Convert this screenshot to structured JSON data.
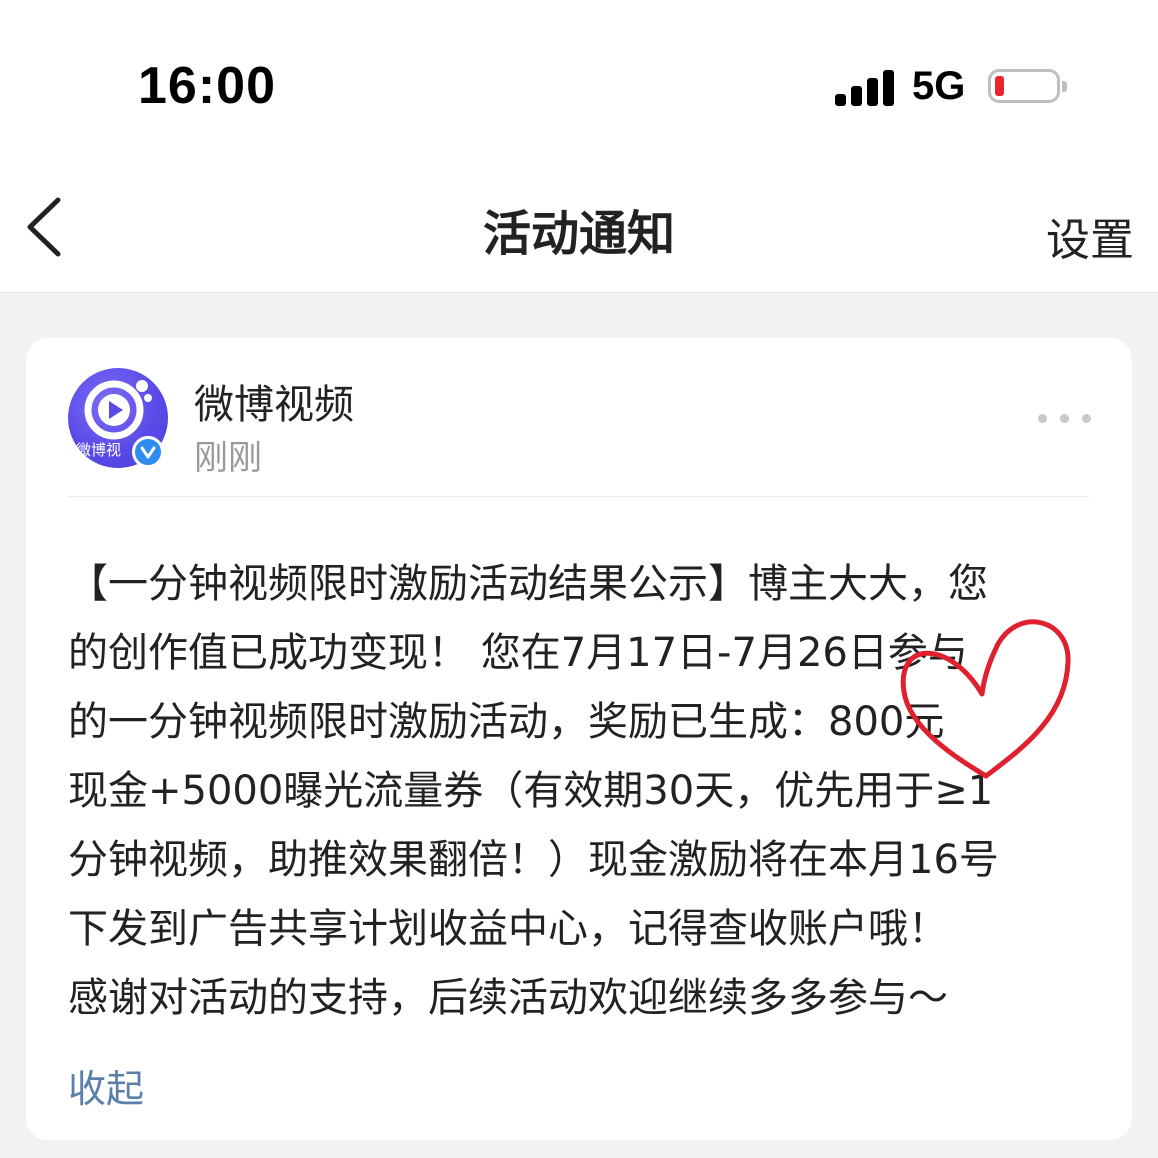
{
  "status_bar": {
    "time": "16:00",
    "network": "5G",
    "battery_color": "#e8262b"
  },
  "nav": {
    "back_icon": "chevron-left-icon",
    "title": "活动通知",
    "settings_label": "设置"
  },
  "notification": {
    "sender": {
      "name": "微博视频",
      "avatar_text": "微博视",
      "verified_icon": "verified-badge-icon"
    },
    "time": "刚刚",
    "more_icon": "more-horizontal-icon",
    "body_lines": [
      "【一分钟视频限时激励活动结果公示】博主大大，您",
      "的创作值已成功变现！ 您在7月17日-7月26日参与",
      "的一分钟视频限时激励活动，奖励已生成：800元",
      "现金+5000曝光流量券（有效期30天，优先用于≥1",
      "分钟视频，助推效果翻倍！）现金激励将在本月16号",
      "下发到广告共享计划收益中心，记得查收账户哦！",
      "感谢对活动的支持，后续活动欢迎继续多多参与～"
    ],
    "collapse_label": "收起"
  },
  "colors": {
    "accent_link": "#5b7fa8",
    "avatar": "#5a4be8",
    "verified": "#2e8cf0",
    "annotation": "#e0202e"
  }
}
